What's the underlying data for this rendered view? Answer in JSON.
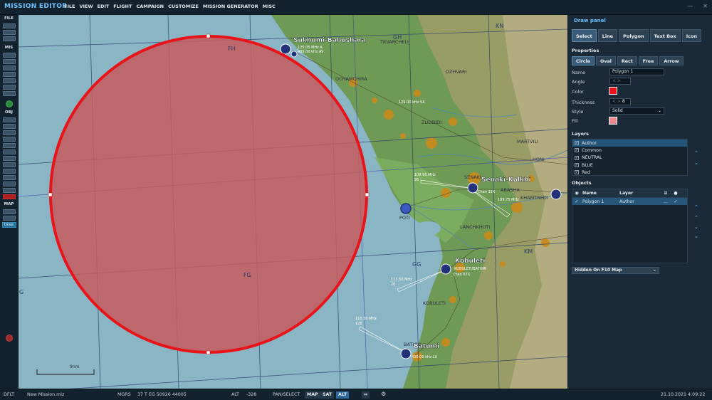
{
  "app": {
    "title": "MISSION EDITOR",
    "menu": [
      "FILE",
      "VIEW",
      "EDIT",
      "FLIGHT",
      "CAMPAIGN",
      "CUSTOMIZE",
      "MISSION GENERATOR",
      "MISC"
    ]
  },
  "left_toolbar": {
    "file_label": "FILE",
    "mis_label": "MIS",
    "obj_label": "OBJ",
    "map_label": "MAP",
    "draw_label": "Draw"
  },
  "map": {
    "grid_labels": [
      "FH",
      "FG",
      "GH",
      "GG",
      "KN",
      "KM",
      "G"
    ],
    "places": [
      "TKVARCHELI",
      "OCHAMCHIRA",
      "DZHVARI",
      "ZUGDIDI",
      "MARTVILI",
      "HONI",
      "SENAKI",
      "ABASHA",
      "KHAMTREDI",
      "POTI",
      "LANCHKHUTI",
      "KOBULETI",
      "BATUMI"
    ],
    "airfields": [
      {
        "name": "Sukhumi-Babushara",
        "freq1": "125.05 MHz A",
        "freq2": "489.00 kHz AV"
      },
      {
        "name": "Senaki-Kolkhi",
        "freq1": "108.90 MHz",
        "freq2": "95",
        "chan": "Chan 31X"
      },
      {
        "name": "Kobuleti",
        "freq1": "111.50 MHz",
        "freq2": "70",
        "chan": "Chan 67X"
      },
      {
        "name": "Batumi",
        "freq1": "110.30 MHz",
        "freq2": "126",
        "chan": "430.00 kHz LU"
      }
    ],
    "nav_freqs": [
      "129.00 kHz 5A",
      "109.75 MHz",
      "KOBULETI/BATUMI"
    ],
    "scale_label": "9nm",
    "colors": {
      "sea": "#8ab5c4",
      "land": "#6f9a55",
      "urban": "#c98a1a",
      "circle_fill": "#c65a5e",
      "circle_stroke": "#e8141a"
    }
  },
  "panel": {
    "title": "Draw panel",
    "tabs": [
      "Select",
      "Line",
      "Polygon",
      "Text Box",
      "Icon"
    ],
    "active_tab": "Select",
    "properties_label": "Properties",
    "shape_tabs": [
      "Circle",
      "Oval",
      "Rect",
      "Free",
      "Arrow"
    ],
    "active_shape": "Circle",
    "name_label": "Name",
    "name_value": "Polygon 1",
    "angle_label": "Angle",
    "angle_value": "0",
    "color_label": "Color",
    "color_value": "#e8141a",
    "thickness_label": "Thickness",
    "thickness_value": "8",
    "style_label": "Style",
    "style_value": "Solid",
    "fill_label": "Fill",
    "fill_value": "#e88a8e",
    "layers_label": "Layers",
    "layers": [
      "Author",
      "Common",
      "NEUTRAL",
      "BLUE",
      "Red"
    ],
    "objects_label": "Objects",
    "obj_cols": [
      "Name",
      "Layer"
    ],
    "objects": [
      {
        "name": "Polygon 1",
        "layer": "Author",
        "extra": "..."
      }
    ],
    "visibility": "Hidden On F10 Map"
  },
  "status": {
    "profile": "DFLT",
    "file": "New Mission.miz",
    "coord_sys": "MGRS",
    "coords": "37 T EG 50926 44005",
    "alt_label": "ALT",
    "alt_value": "-328",
    "mode": "PAN/SELECT",
    "map_btn": "MAP",
    "sat_btn": "SAT",
    "alt_btn": "ALT",
    "datetime": "21.10.2021 4:09:22"
  }
}
